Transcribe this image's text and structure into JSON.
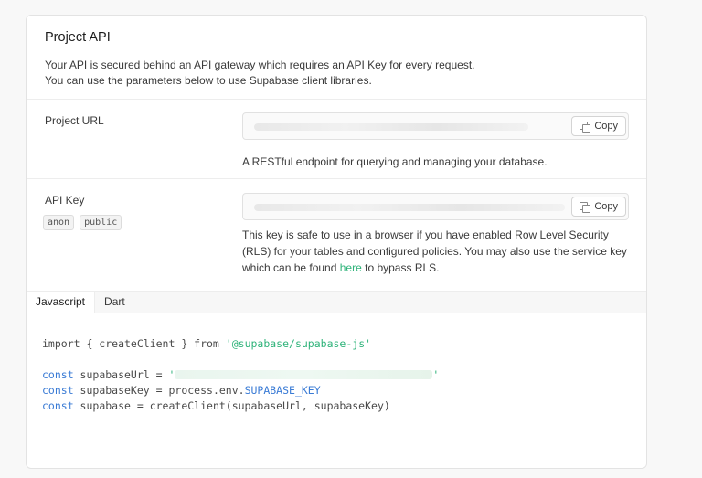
{
  "panel": {
    "title": "Project API",
    "description_line1": "Your API is secured behind an API gateway which requires an API Key for every request.",
    "description_line2": "You can use the parameters below to use Supabase client libraries."
  },
  "project_url": {
    "label": "Project URL",
    "copy_label": "Copy",
    "help": "A RESTful endpoint for querying and managing your database."
  },
  "api_key": {
    "label": "API Key",
    "badges": [
      "anon",
      "public"
    ],
    "copy_label": "Copy",
    "help_prefix": "This key is safe to use in a browser if you have enabled Row Level Security (RLS) for your tables and configured policies. You may also use the service key which can be found ",
    "help_link": "here",
    "help_suffix": " to bypass RLS."
  },
  "tabs": [
    {
      "label": "Javascript",
      "active": true
    },
    {
      "label": "Dart",
      "active": false
    }
  ],
  "code": {
    "line1_plain": "import { createClient } from ",
    "line1_string": "'@supabase/supabase-js'",
    "kw_const": "const",
    "line3_plain": " supabaseUrl = ",
    "quote": "'",
    "line4_plain": " supabaseKey = process.env.",
    "line4_kw": "SUPABASE_KEY",
    "line5_plain": " supabase = createClient(supabaseUrl, supabaseKey)"
  },
  "colors": {
    "accent": "#2fb37a",
    "keyword": "#3a7bd5"
  }
}
